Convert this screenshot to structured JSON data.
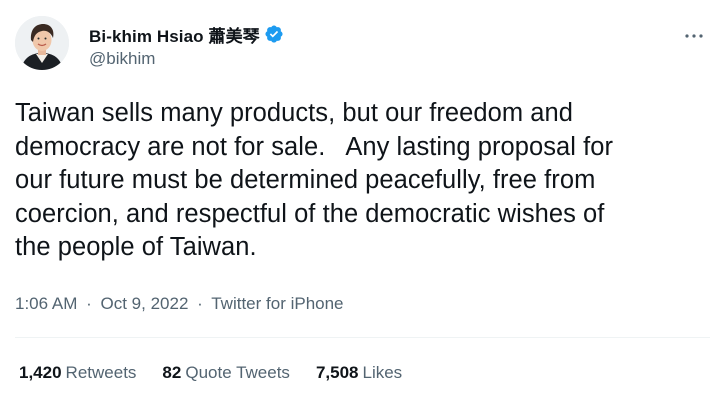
{
  "author": {
    "display_name": "Bi-khim Hsiao 蕭美琴",
    "handle": "@bikhim",
    "verified_icon": "verified-badge-icon",
    "avatar_icon": "user-avatar"
  },
  "tweet": {
    "text": "Taiwan sells many products, but our freedom and\ndemocracy are not for sale.   Any lasting proposal for\nour future must be determined peacefully, free from\ncoercion, and respectful of the democratic wishes of\nthe people of Taiwan."
  },
  "meta": {
    "time": "1:06 AM",
    "separator": "·",
    "date": "Oct 9, 2022",
    "source": "Twitter for iPhone"
  },
  "stats": [
    {
      "count": "1,420",
      "label": "Retweets"
    },
    {
      "count": "82",
      "label": "Quote Tweets"
    },
    {
      "count": "7,508",
      "label": "Likes"
    }
  ],
  "colors": {
    "text_primary": "#0f1419",
    "text_secondary": "#536471",
    "verified_blue": "#1d9bf0",
    "divider": "#eff3f4"
  },
  "icons": {
    "more": "more-dots-icon"
  }
}
